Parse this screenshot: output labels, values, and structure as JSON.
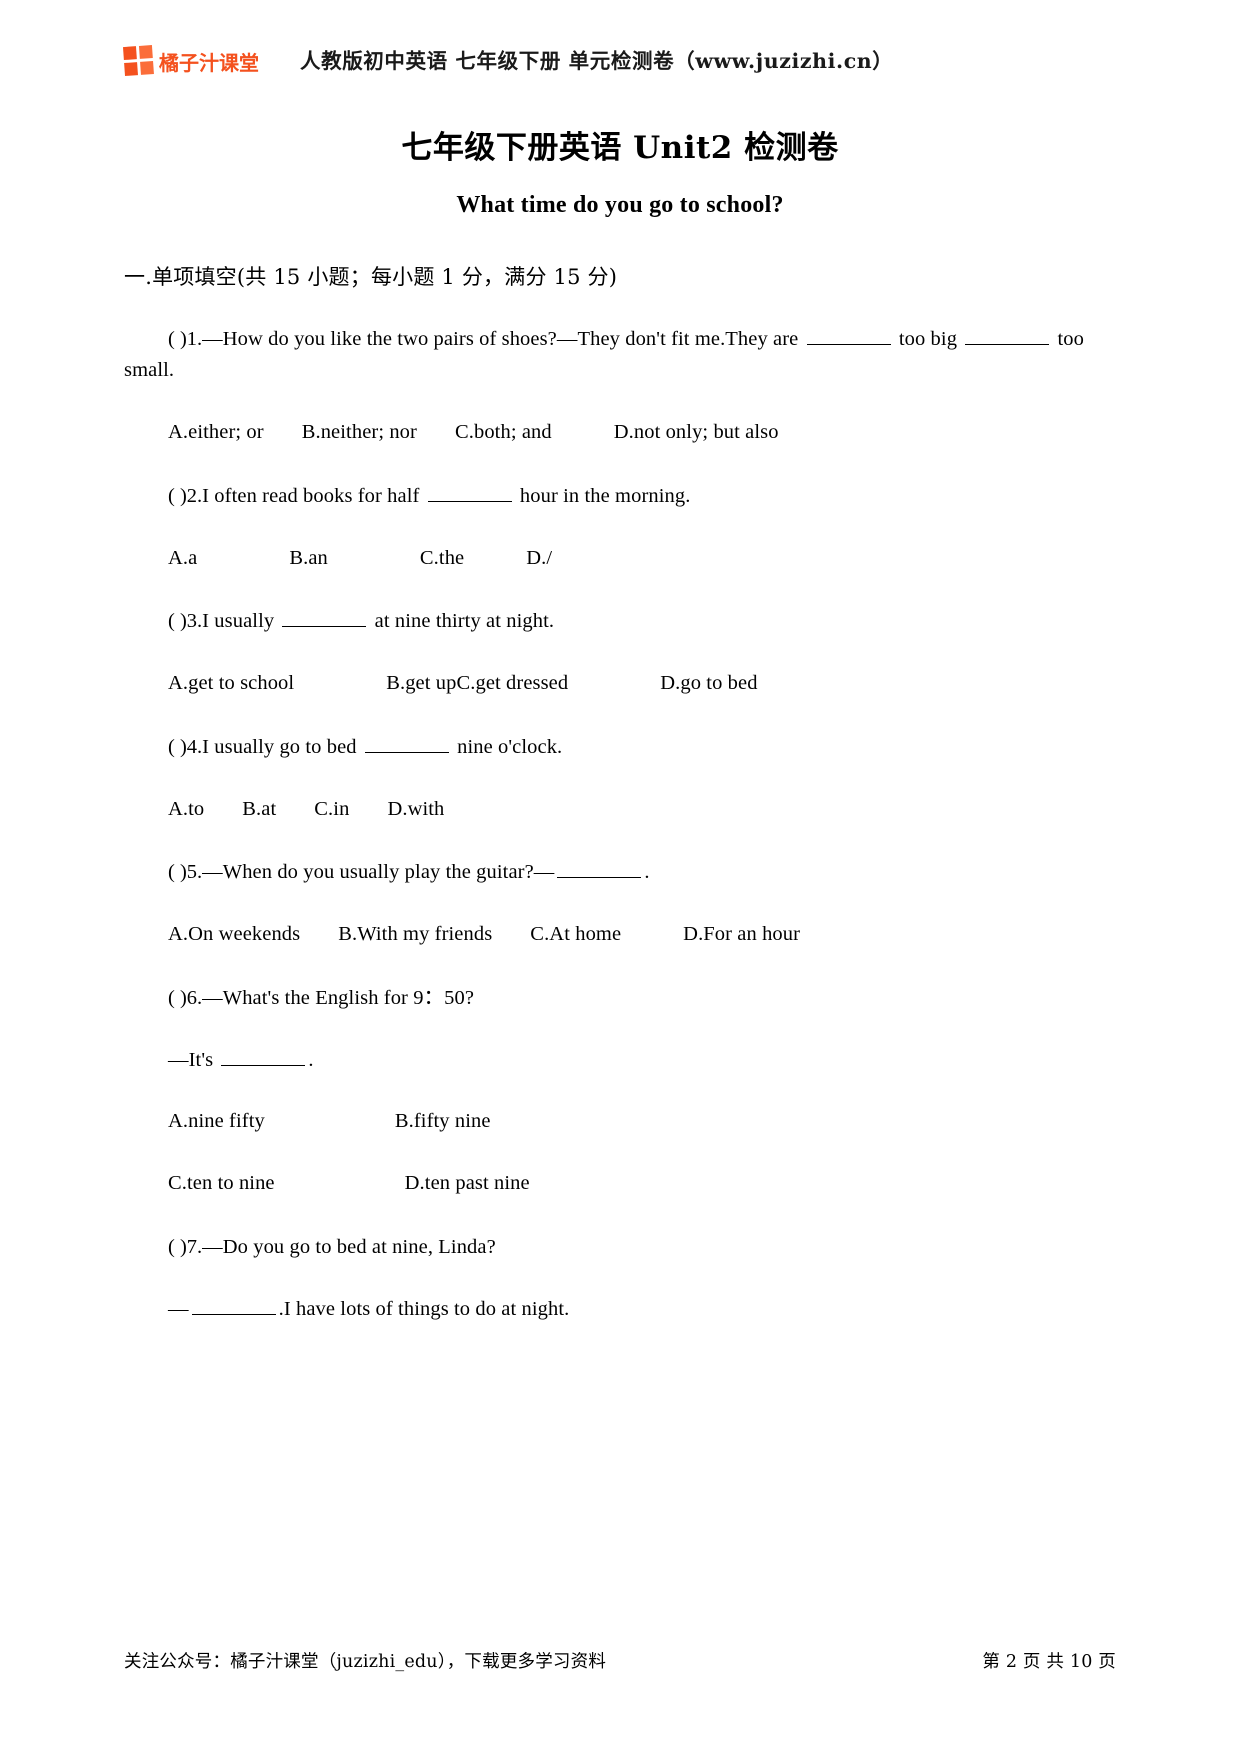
{
  "header": {
    "brand_name": "橘子汁课堂",
    "title": "人教版初中英语 七年级下册 单元检测卷（www.juzizhi.cn）"
  },
  "title": "七年级下册英语 Unit2 检测卷",
  "subtitle": "What time do you go to school?",
  "section": {
    "heading": "一.单项填空(共 15 小题；每小题 1 分，满分 15 分)"
  },
  "questions": [
    {
      "marker": "(       )1.",
      "stem_pre": "—How do you like the two pairs of shoes?—They don't fit me.They are ",
      "stem_mid": " too big ",
      "stem_post": " too small.",
      "options_line1": "A.either; or",
      "options_line2": "B.neither; nor",
      "options_line3": "C.both; and",
      "options_line4": "D.not only; but also"
    },
    {
      "marker": "(       )2.",
      "stem_pre": "I often read books for half ",
      "stem_post": " hour in the morning.",
      "options_line1": "A.a",
      "options_line2": "B.an",
      "options_line3": "C.the",
      "options_line4": "D./"
    },
    {
      "marker": "(       )3.",
      "stem_pre": "I usually ",
      "stem_post": " at nine thirty at night.",
      "options_line1": "A.get to school",
      "options_line2": "B.get upC.get dressed",
      "options_line3": "D.go to bed"
    },
    {
      "marker": "(       )4.",
      "stem_pre": "I usually go to bed ",
      "stem_post": " nine o'clock.",
      "options_line1": "A.to",
      "options_line2": "B.at",
      "options_line3": "C.in",
      "options_line4": "D.with"
    },
    {
      "marker": "(       )5.",
      "stem_pre": "—When do you usually play the guitar?—",
      "stem_post": ".",
      "options_line1": "A.On weekends",
      "options_line2": "B.With my friends",
      "options_line3": "C.At home",
      "options_line4": "D.For an hour"
    },
    {
      "marker": "(       )6.",
      "stem_pre": "—What's the English for 9：50?",
      "cont_pre": "—It's ",
      "cont_post": ".",
      "options_row1_a": "A.nine fifty",
      "options_row1_b": "B.fifty nine",
      "options_row2_a": "C.ten to nine",
      "options_row2_b": "D.ten past nine"
    },
    {
      "marker": "(       )7.",
      "stem_pre": "—Do you go to bed at nine, Linda?",
      "cont_pre": "—",
      "cont_post": ".I have lots of things to do at night."
    }
  ],
  "footer": {
    "left": "关注公众号：橘子汁课堂（juzizhi_edu），下载更多学习资料",
    "right": "第 2 页 共 10 页"
  }
}
